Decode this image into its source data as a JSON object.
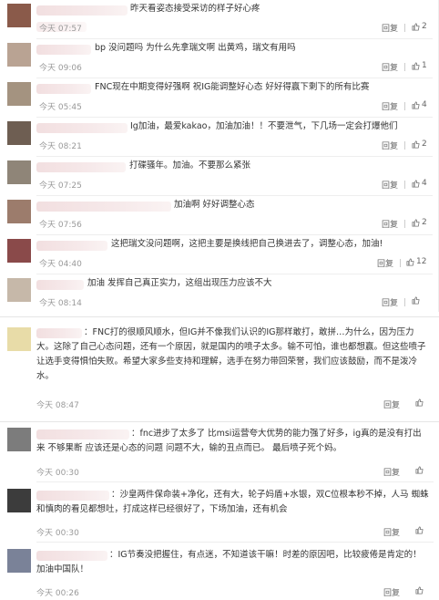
{
  "actions": {
    "reply": "回复",
    "separator": "|"
  },
  "top_comments": [
    {
      "text": "昨天看姿态接受采访的样子好心疼",
      "time": "今天 07:57",
      "likes": "2",
      "avatar_color": "#8a5a4a"
    },
    {
      "text": "bp 没问题吗 为什么先拿瑞文啊 出黄鸡，瑞文有用吗",
      "time": "今天 09:06",
      "likes": "1",
      "avatar_color": "#b9a393"
    },
    {
      "text": "FNC现在中期变得好强啊 祝IG能调整好心态 好好得赢下剩下的所有比赛",
      "time": "今天 05:45",
      "likes": "4",
      "avatar_color": "#a49380"
    },
    {
      "text": "Ig加油，最爱kakao，加油加油！！不要泄气，下几场一定会打爆他们",
      "time": "今天 08:21",
      "likes": "2",
      "avatar_color": "#6e5e52"
    },
    {
      "text": "打碟骚年。加油。不要那么紧张",
      "time": "今天 07:25",
      "likes": "4",
      "avatar_color": "#8f8578"
    },
    {
      "text": "加油啊 好好调整心态",
      "time": "今天 07:56",
      "likes": "2",
      "avatar_color": "#9c7c6c"
    },
    {
      "text": "这把瑞文没问题啊，这把主要是换线把自己换进去了，调整心态，加油!",
      "time": "今天 04:40",
      "likes": "12",
      "avatar_color": "#8a4a4a"
    },
    {
      "text": "加油 发挥自己真正实力，这组出现压力应该不大",
      "time": "今天 08:14",
      "likes": "",
      "avatar_color": "#c6b8a9"
    }
  ],
  "mid_comment": {
    "text": "：FNC打的很顺风顺水，但IG并不像我们认识的IG那样敢打，敢拼…为什么，因为压力大。这除了自己心态问题，还有一个原因，就是国内的喷子太多。输不可怕，谁也都想赢。但这些喷子让选手变得惧怕失败。希望大家多些支持和理解，选手在努力带回荣誉，我们应该鼓励，而不是泼冷水。",
    "time": "今天 08:47",
    "avatar_color": "#e8dca8"
  },
  "bot_comments": [
    {
      "text": "：fnc进步了太多了 比msi运营夸大优势的能力强了好多，ig真的是没有打出来 不够果断 应该还是心态的问题 问题不大，输的丑点而已。 最后喷子死个妈。",
      "time": "今天 00:30",
      "avatar_color": "#7c7c7c"
    },
    {
      "text": "：沙皇两件保命装+净化，还有大，轮子妈盾+水银，双C位根本秒不掉，人马 蜘蛛和慎肉的看见都想吐，打成这样已经很好了，下场加油，还有机会",
      "time": "今天 00:30",
      "avatar_color": "#3c3c3c"
    },
    {
      "text": "：IG节奏没把握住，有点迷，不知道该干嘛！时差的原因吧，比较疲倦是肯定的！加油中国队！",
      "time": "今天 00:26",
      "avatar_color": "#7a8298"
    }
  ]
}
